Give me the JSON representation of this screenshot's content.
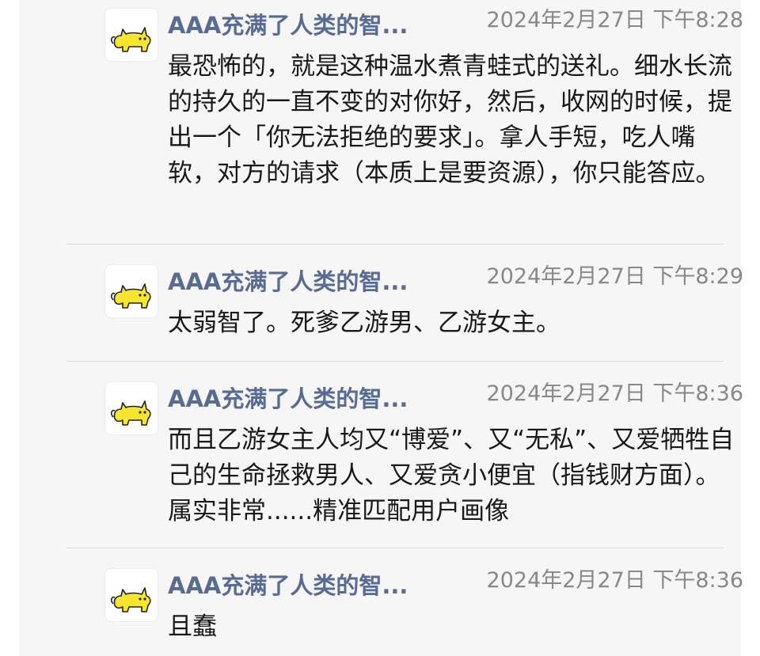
{
  "comments": [
    {
      "author": "AAA充满了人类的智...",
      "time": "2024年2月27日 下午8:28",
      "text": "最恐怖的，就是这种温水煮青蛙式的送礼。细水长流的持久的一直不变的对你好，然后，收网的时候，提出一个「你无法拒绝的要求」。拿人手短，吃人嘴软，对方的请求（本质上是要资源），你只能答应。"
    },
    {
      "author": "AAA充满了人类的智...",
      "time": "2024年2月27日 下午8:29",
      "text": "太弱智了。死爹乙游男、乙游女主。"
    },
    {
      "author": "AAA充满了人类的智...",
      "time": "2024年2月27日 下午8:36",
      "text": "而且乙游女主人均又“博爱”、又“无私”、又爱牺牲自己的生命拯救男人、又爱贪小便宜（指钱财方面）。属实非常......精准匹配用户画像"
    },
    {
      "author": "AAA充满了人类的智...",
      "time": "2024年2月27日 下午8:36",
      "text": "且蠢"
    }
  ],
  "avatar_icon": "yellow-cat-icon",
  "colors": {
    "author": "#576b95",
    "time": "#888888",
    "text": "#191919",
    "panel": "#f6f6f6"
  }
}
